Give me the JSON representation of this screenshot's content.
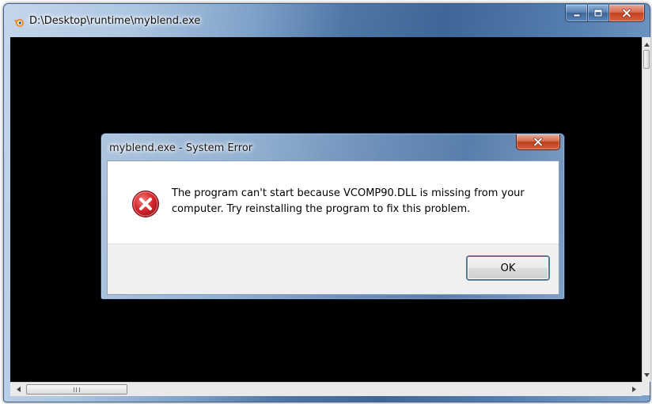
{
  "console_window": {
    "title": "D:\\Desktop\\runtime\\myblend.exe",
    "app_icon": "blender-icon",
    "caption_buttons": [
      "minimize-icon",
      "maximize-icon",
      "close-icon"
    ],
    "hscroll_grip": "III"
  },
  "dialog": {
    "title": "myblend.exe - System Error",
    "icon": "error-icon",
    "message": "The program can't start because VCOMP90.DLL is missing from your computer. Try reinstalling the program to fix this problem.",
    "ok_label": "OK"
  },
  "colors": {
    "error_red": "#c8202a",
    "close_red": "#c2401f",
    "console_background": "#000000"
  }
}
